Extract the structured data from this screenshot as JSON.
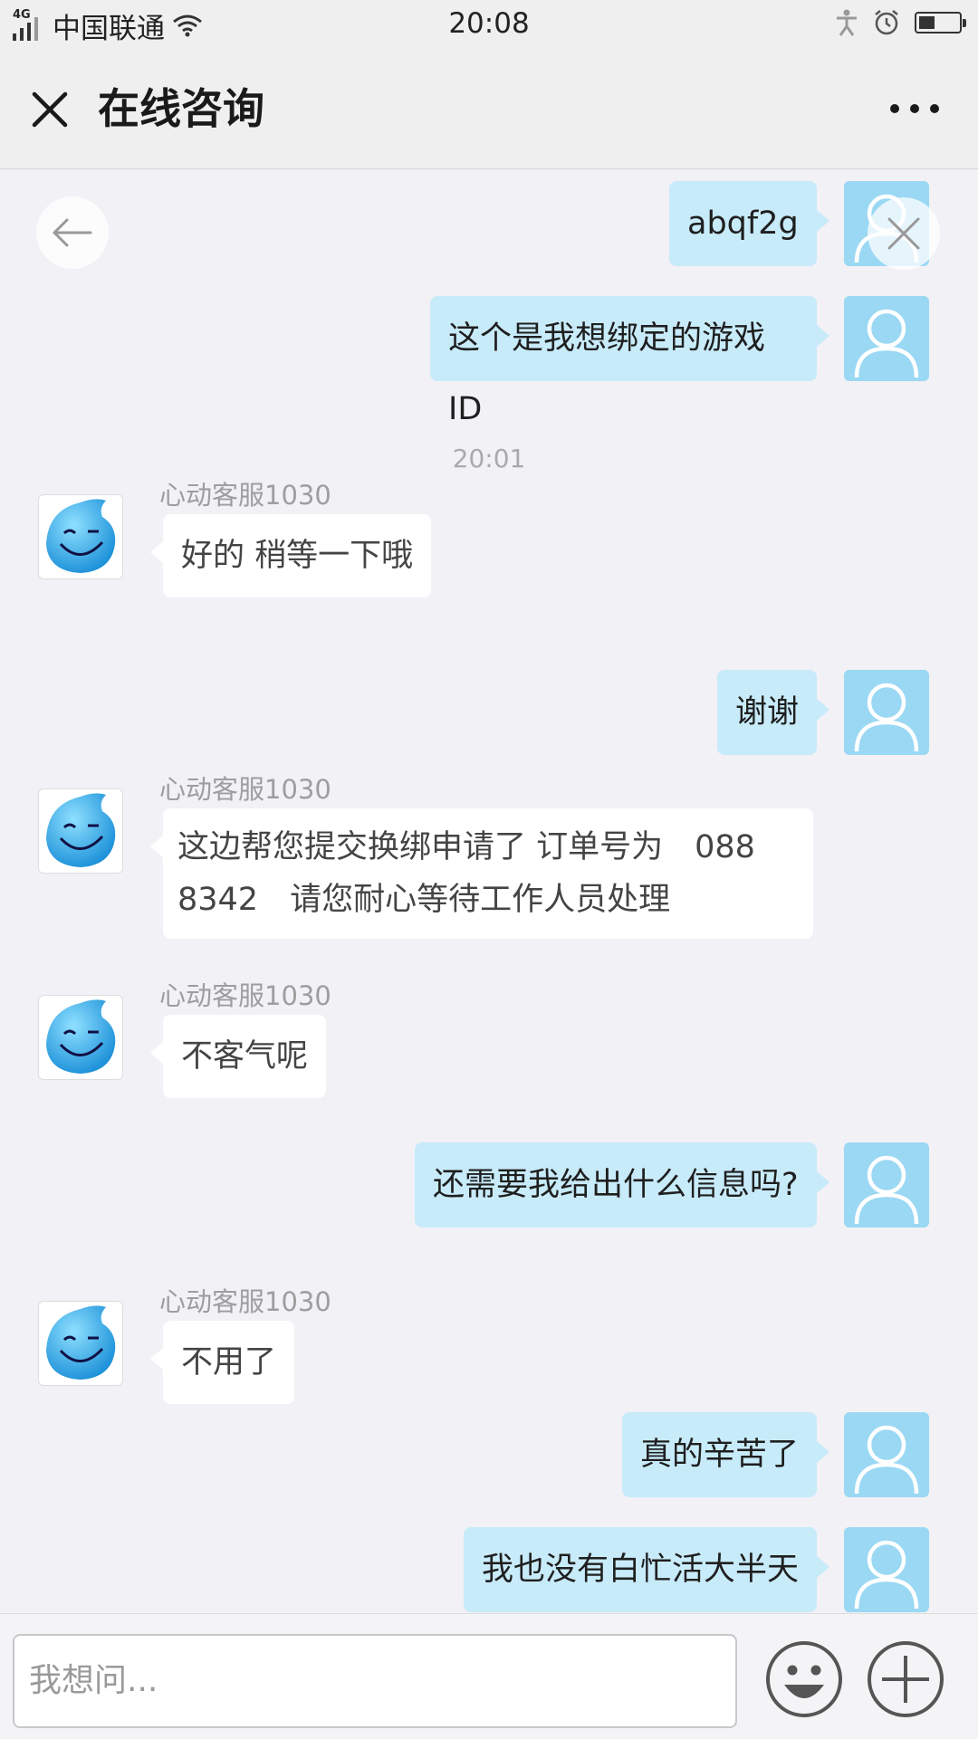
{
  "status_bar": {
    "network": "4G",
    "carrier": "中国联通",
    "time": "20:08",
    "battery_level": 0.4
  },
  "nav": {
    "title": "在线咨询"
  },
  "messages": [
    {
      "direction": "out",
      "text": "abqf2g"
    },
    {
      "direction": "out",
      "text": "这个是我想绑定的游戏ID"
    },
    {
      "type": "timestamp",
      "text": "20:01"
    },
    {
      "direction": "in",
      "sender": "心动客服1030",
      "text": "好的 稍等一下哦"
    },
    {
      "direction": "out",
      "text": "谢谢"
    },
    {
      "direction": "in",
      "sender": "心动客服1030",
      "lines": [
        "这边帮您提交换绑申请了 订单号为　088",
        "8342　请您耐心等待工作人员处理"
      ]
    },
    {
      "direction": "in",
      "sender": "心动客服1030",
      "text": "不客气呢"
    },
    {
      "direction": "out",
      "text": "还需要我给出什么信息吗?"
    },
    {
      "direction": "in",
      "sender": "心动客服1030",
      "text": "不用了"
    },
    {
      "direction": "out",
      "text": "真的辛苦了"
    },
    {
      "direction": "out",
      "text": "我也没有白忙活大半天"
    }
  ],
  "input": {
    "placeholder": "我想问..."
  },
  "colors": {
    "outgoing_bubble": "#c8ebfa",
    "incoming_bubble": "#ffffff",
    "user_avatar": "#9ad8f3",
    "agent_avatar": "#2aa7e8"
  }
}
